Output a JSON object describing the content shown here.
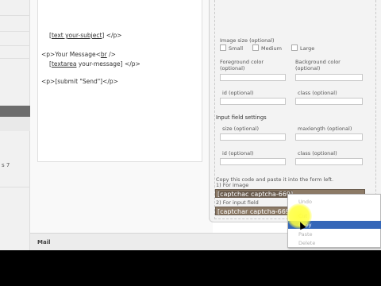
{
  "sidebar": {
    "count": "s 7"
  },
  "editor": {
    "lines": [
      "[text your-subject] </p>",
      "<p>Your Message<br />",
      "[textarea your-message] </p>",
      "<p>[submit \"Send\"]</p>"
    ],
    "line1_prefix": "[",
    "line1_underlined": "text your-subject",
    "line1_suffix": "] </p>",
    "line2_prefix": "<p>Your Message<",
    "line2_underlined": "br",
    "line2_suffix": " />",
    "line3_prefix": "[",
    "line3_underlined": "textarea",
    "line3_suffix": " your-message] </p>",
    "line4": "<p>[submit \"Send\"]</p>"
  },
  "tag_generator": {
    "image_size_label": "Image size (optional)",
    "size_options": [
      "Small",
      "Medium",
      "Large"
    ],
    "fg_label": "Foreground color",
    "fg_optional": "(optional)",
    "bg_label": "Background color",
    "bg_optional": "(optional)",
    "id_label": "id (optional)",
    "class_label": "class (optional)",
    "input_settings_label": "Input field settings",
    "size_label": "size (optional)",
    "maxlength_label": "maxlength (optional)",
    "id2_label": "id (optional)",
    "class2_label": "class (optional)",
    "copy_instruction": "Copy this code and paste it into the form left.",
    "for_image_label": "1) For image",
    "for_input_label": "2) For input field",
    "image_code": "[captchac captcha-669]",
    "input_code": "[captchar captcha-669]"
  },
  "mail": {
    "label": "Mail"
  },
  "context_menu": {
    "items": [
      "Undo",
      "Cut",
      "Copy",
      "Paste",
      "Delete"
    ],
    "active": "Copy"
  },
  "colors": {
    "code_bg": "#8c7a66",
    "menu_highlight": "#3567b8",
    "cursor_highlight": "#ffff3c"
  }
}
